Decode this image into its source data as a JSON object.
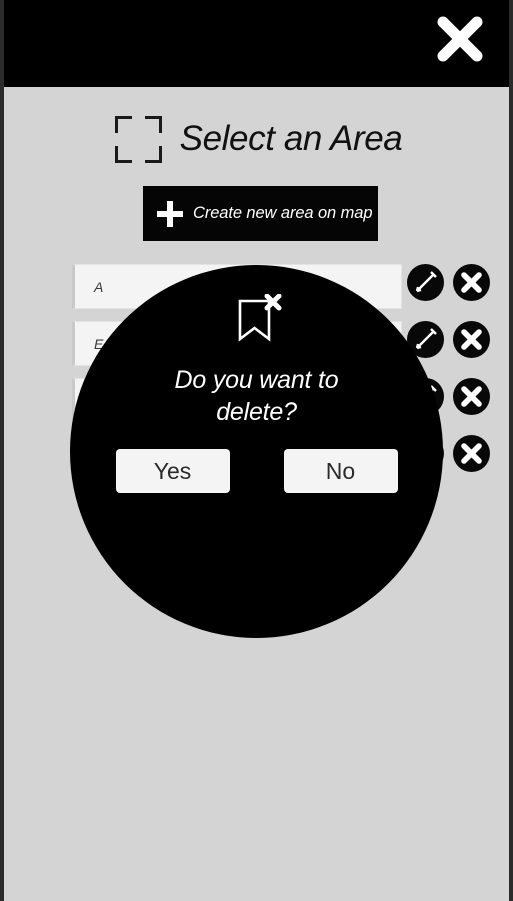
{
  "window": {
    "background_color": "#d4d4d4",
    "topbar_color": "#000000"
  },
  "topbar": {
    "close_icon": "close-icon"
  },
  "header": {
    "title": "Select an Area",
    "icon": "crop-frame-icon"
  },
  "create_button": {
    "label": "Create new area on map",
    "icon": "plus-icon"
  },
  "area_list": {
    "edit_icon": "pencil-icon",
    "delete_icon": "close-circle-icon",
    "rows": [
      {
        "value": "A",
        "placeholder": ""
      },
      {
        "value": "E",
        "placeholder": ""
      },
      {
        "value": "",
        "placeholder": ""
      },
      {
        "value": "",
        "placeholder": ""
      }
    ]
  },
  "confirm_dialog": {
    "icon": "bookmark-remove-icon",
    "message": "Do you want to delete?",
    "yes_label": "Yes",
    "no_label": "No",
    "background_color": "#000000",
    "button_color": "#f4f4f4"
  }
}
